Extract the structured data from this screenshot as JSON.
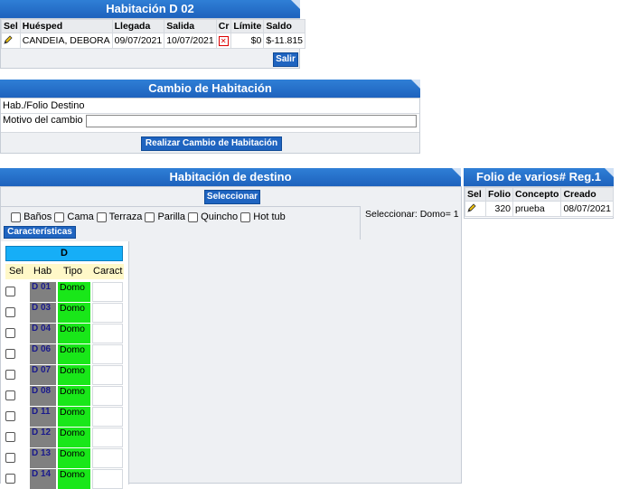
{
  "room_panel": {
    "title": "Habitación D 02",
    "columns": [
      "Sel",
      "Huésped",
      "Llegada",
      "Salida",
      "Cr",
      "Límite",
      "Saldo"
    ],
    "row": {
      "guest": "CANDEIA, DEBORA",
      "arrival": "09/07/2021",
      "departure": "10/07/2021",
      "limit": "$0",
      "balance": "$-11.815"
    },
    "exit_label": "Salir"
  },
  "change_panel": {
    "title": "Cambio de Habitación",
    "dest_label": "Hab./Folio Destino",
    "reason_label": "Motivo del cambio",
    "reason_value": "",
    "submit_label": "Realizar Cambio de Habitación"
  },
  "dest_panel": {
    "title": "Habitación de destino",
    "select_label": "Seleccionar",
    "features": [
      "Baños",
      "Cama",
      "Terraza",
      "Parilla",
      "Quincho",
      "Hot tub"
    ],
    "characteristics_label": "Características",
    "selection_status": "Seleccionar: Domo= 1",
    "group_label": "D",
    "columns": [
      "Sel",
      "Hab",
      "Tipo",
      "Caract"
    ],
    "rooms": [
      {
        "hab": "D 01",
        "tipo": "Domo"
      },
      {
        "hab": "D 03",
        "tipo": "Domo"
      },
      {
        "hab": "D 04",
        "tipo": "Domo"
      },
      {
        "hab": "D 06",
        "tipo": "Domo"
      },
      {
        "hab": "D 07",
        "tipo": "Domo"
      },
      {
        "hab": "D 08",
        "tipo": "Domo"
      },
      {
        "hab": "D 11",
        "tipo": "Domo"
      },
      {
        "hab": "D 12",
        "tipo": "Domo"
      },
      {
        "hab": "D 13",
        "tipo": "Domo"
      },
      {
        "hab": "D 14",
        "tipo": "Domo"
      }
    ]
  },
  "folio_panel": {
    "title": "Folio de varios# Reg.1",
    "columns": [
      "Sel",
      "Folio",
      "Concepto",
      "Creado"
    ],
    "row": {
      "folio": "320",
      "concept": "prueba",
      "created": "08/07/2021"
    }
  },
  "colors": {
    "header": "#1e62bd",
    "room_cell": "#808080",
    "type_cell": "#19e719",
    "group_header": "#16aef7"
  }
}
